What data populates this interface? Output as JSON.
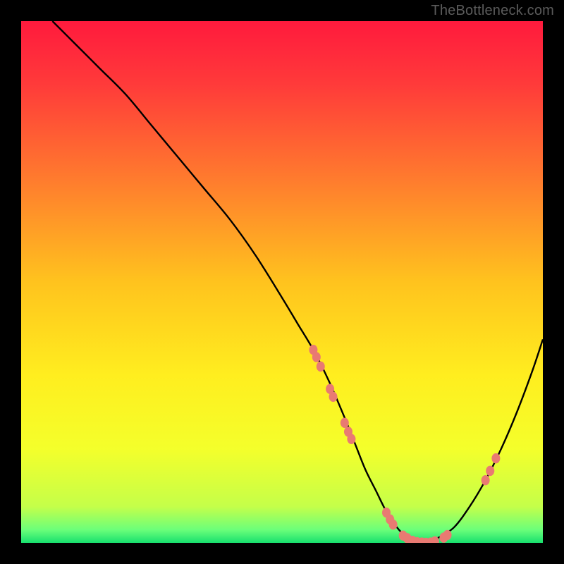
{
  "watermark": "TheBottleneck.com",
  "chart_data": {
    "type": "line",
    "title": "",
    "xlabel": "",
    "ylabel": "",
    "xlim": [
      0,
      100
    ],
    "ylim": [
      0,
      100
    ],
    "gradient_stops": [
      {
        "offset": 0.0,
        "color": "#ff1a3d"
      },
      {
        "offset": 0.12,
        "color": "#ff3a3a"
      },
      {
        "offset": 0.3,
        "color": "#ff7a2e"
      },
      {
        "offset": 0.5,
        "color": "#ffc31e"
      },
      {
        "offset": 0.68,
        "color": "#ffee1f"
      },
      {
        "offset": 0.82,
        "color": "#f4ff2b"
      },
      {
        "offset": 0.93,
        "color": "#c5ff49"
      },
      {
        "offset": 0.975,
        "color": "#6bff7a"
      },
      {
        "offset": 1.0,
        "color": "#18e06e"
      }
    ],
    "series": [
      {
        "name": "curve",
        "x": [
          6,
          10,
          15,
          20,
          25,
          30,
          35,
          40,
          45,
          50,
          53,
          56,
          59,
          62,
          64,
          66,
          68,
          70,
          72,
          74,
          76,
          78,
          80,
          83,
          86,
          89,
          92,
          95,
          98,
          100
        ],
        "y": [
          100,
          96,
          91,
          86,
          80,
          74,
          68,
          62,
          55,
          47,
          42,
          37,
          31,
          24,
          19,
          14,
          10,
          6,
          3,
          1,
          0,
          0,
          1,
          3,
          7,
          12,
          18,
          25,
          33,
          39
        ]
      }
    ],
    "markers": [
      {
        "x": 56.0,
        "y": 37.0
      },
      {
        "x": 56.6,
        "y": 35.6
      },
      {
        "x": 57.4,
        "y": 33.8
      },
      {
        "x": 59.2,
        "y": 29.5
      },
      {
        "x": 59.8,
        "y": 28.0
      },
      {
        "x": 62.0,
        "y": 23.0
      },
      {
        "x": 62.7,
        "y": 21.3
      },
      {
        "x": 63.3,
        "y": 19.9
      },
      {
        "x": 70.0,
        "y": 5.8
      },
      {
        "x": 70.7,
        "y": 4.5
      },
      {
        "x": 71.3,
        "y": 3.5
      },
      {
        "x": 73.2,
        "y": 1.4
      },
      {
        "x": 74.0,
        "y": 0.9
      },
      {
        "x": 75.0,
        "y": 0.4
      },
      {
        "x": 75.9,
        "y": 0.15
      },
      {
        "x": 76.8,
        "y": 0.05
      },
      {
        "x": 77.6,
        "y": 0.0
      },
      {
        "x": 78.5,
        "y": 0.05
      },
      {
        "x": 79.3,
        "y": 0.3
      },
      {
        "x": 81.0,
        "y": 1.0
      },
      {
        "x": 81.7,
        "y": 1.5
      },
      {
        "x": 89.0,
        "y": 12.0
      },
      {
        "x": 89.9,
        "y": 13.8
      },
      {
        "x": 91.0,
        "y": 16.2
      }
    ],
    "marker_color": "#e97a72",
    "curve_color": "#000000"
  }
}
